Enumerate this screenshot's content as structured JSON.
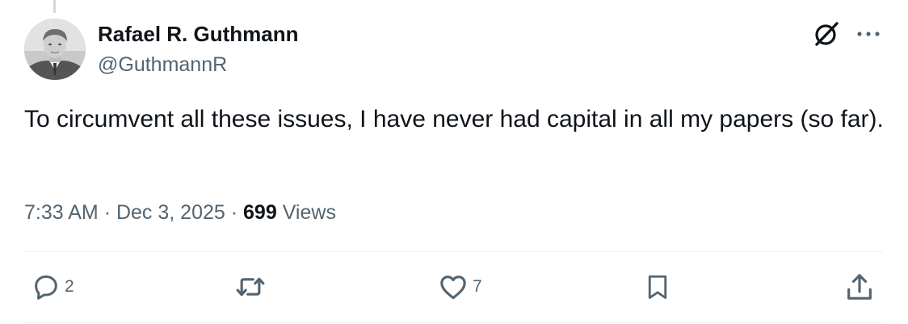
{
  "tweet": {
    "author": {
      "display_name": "Rafael R. Guthmann",
      "handle": "@GuthmannR",
      "avatar_icon": "profile-photo"
    },
    "text": "To circumvent all these issues, I have never had capital in all my papers (so far).",
    "time": "7:33 AM",
    "separator": "·",
    "date": "Dec 3, 2025",
    "views_count": "699",
    "views_label": "Views"
  },
  "header_icons": {
    "grok": "grok-icon",
    "more": "more-dots-icon"
  },
  "actions": {
    "reply": {
      "icon": "reply-icon",
      "count": "2"
    },
    "retweet": {
      "icon": "retweet-icon",
      "count": ""
    },
    "like": {
      "icon": "heart-icon",
      "count": "7"
    },
    "bookmark": {
      "icon": "bookmark-icon",
      "count": ""
    },
    "share": {
      "icon": "share-icon",
      "count": ""
    }
  },
  "colors": {
    "text_primary": "#0f1419",
    "text_secondary": "#536471",
    "divider": "#eff3f4",
    "thread_line": "#cfd9de"
  }
}
